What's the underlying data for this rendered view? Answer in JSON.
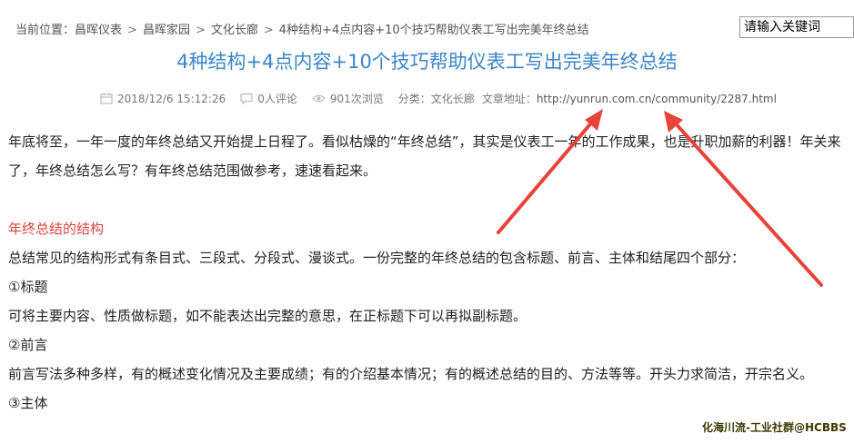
{
  "breadcrumb": {
    "prefix": "当前位置：",
    "items": [
      "昌晖仪表",
      "昌晖家园",
      "文化长廊",
      "4种结构+4点内容+10个技巧帮助仪表工写出完美年终总结"
    ],
    "separator": ">"
  },
  "search": {
    "placeholder": "请输入关键词"
  },
  "article": {
    "title": "4种结构+4点内容+10个技巧帮助仪表工写出完美年终总结",
    "meta": {
      "date": "2018/12/6 15:12:26",
      "comments": "0人评论",
      "views": "901次浏览",
      "category": "分类：文化长廊",
      "url_label": "文章地址：",
      "url": "http://yunrun.com.cn/community/2287.html"
    },
    "paragraphs": [
      "年底将至，一年一度的年终总结又开始提上日程了。看似枯燥的“年终总结”，其实是仪表工一年的工作成果，也是升职加薪的利器！年关来了，年终总结怎么写？有年终总结范围做参考，速速看起来。",
      "",
      "年终总结的结构",
      "总结常见的结构形式有条目式、三段式、分段式、漫谈式。一份完整的年终总结的包含标题、前言、主体和结尾四个部分：",
      "①标题",
      "可将主要内容、性质做标题，如不能表达出完整的意思，在正标题下可以再拟副标题。",
      "②前言",
      "前言写法多种多样，有的概述变化情况及主要成绩；有的介绍基本情况；有的概述总结的目的、方法等等。开头力求简洁，开宗名义。",
      "③主体"
    ]
  },
  "watermark": "化海川流-工业社群@HCBBS",
  "colors": {
    "title": "#3a86c8",
    "section": "#e0443a",
    "arrow": "#e8433a"
  }
}
